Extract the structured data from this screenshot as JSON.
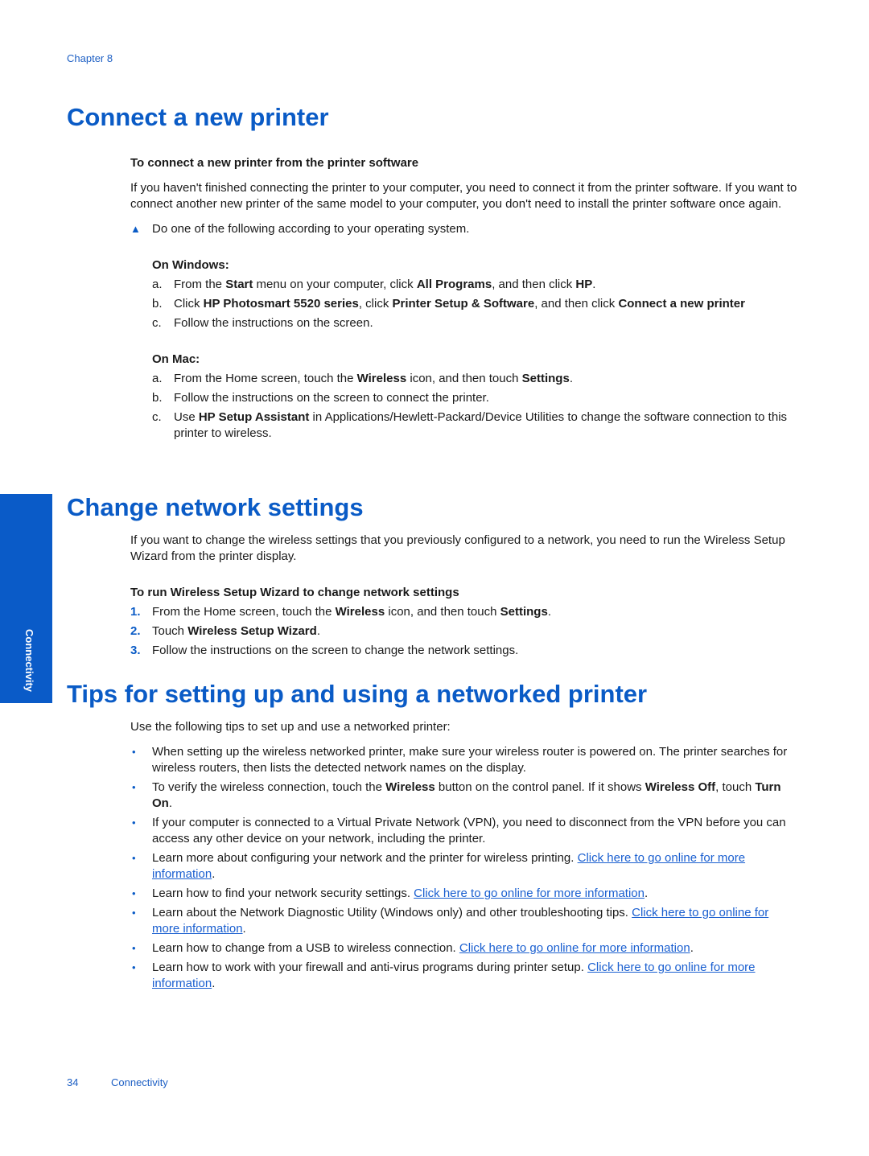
{
  "header": {
    "chapter": "Chapter 8"
  },
  "section1": {
    "title": "Connect a new printer",
    "subheading": "To connect a new printer from the printer software",
    "intro": "If you haven't finished connecting the printer to your computer, you need to connect it from the printer software. If you want to connect another new printer of the same model to your computer, you don't need to install the printer software once again.",
    "instruction": "Do one of the following according to your operating system.",
    "windows": {
      "label": "On Windows:",
      "steps": [
        {
          "marker": "a.",
          "parts": [
            "From the ",
            "Start",
            " menu on your computer, click ",
            "All Programs",
            ", and then click ",
            "HP",
            "."
          ]
        },
        {
          "marker": "b.",
          "parts": [
            "Click ",
            "HP Photosmart 5520 series",
            ", click ",
            "Printer Setup & Software",
            ", and then click ",
            "Connect a new printer",
            ""
          ]
        },
        {
          "marker": "c.",
          "parts": [
            "Follow the instructions on the screen."
          ]
        }
      ]
    },
    "mac": {
      "label": "On Mac:",
      "steps": [
        {
          "marker": "a.",
          "parts": [
            "From the Home screen, touch the ",
            "Wireless",
            " icon, and then touch ",
            "Settings",
            "."
          ]
        },
        {
          "marker": "b.",
          "parts": [
            "Follow the instructions on the screen to connect the printer."
          ]
        },
        {
          "marker": "c.",
          "parts": [
            "Use ",
            "HP Setup Assistant",
            " in Applications/Hewlett-Packard/Device Utilities to change the software connection to this printer to wireless."
          ]
        }
      ]
    }
  },
  "section2": {
    "title": "Change network settings",
    "intro": "If you want to change the wireless settings that you previously configured to a network, you need to run the Wireless Setup Wizard from the printer display.",
    "subheading": "To run Wireless Setup Wizard to change network settings",
    "steps": [
      {
        "marker": "1.",
        "parts": [
          "From the Home screen, touch the ",
          "Wireless",
          " icon, and then touch ",
          "Settings",
          "."
        ]
      },
      {
        "marker": "2.",
        "parts": [
          "Touch ",
          "Wireless Setup Wizard",
          "."
        ]
      },
      {
        "marker": "3.",
        "parts": [
          "Follow the instructions on the screen to change the network settings."
        ]
      }
    ]
  },
  "section3": {
    "title": "Tips for setting up and using a networked printer",
    "intro": "Use the following tips to set up and use a networked printer:",
    "tips": [
      {
        "parts": [
          "When setting up the wireless networked printer, make sure your wireless router is powered on. The printer searches for wireless routers, then lists the detected network names on the display."
        ]
      },
      {
        "parts": [
          "To verify the wireless connection, touch the ",
          "Wireless",
          " button on the control panel. If it shows ",
          "Wireless Off",
          ", touch ",
          "Turn On",
          "."
        ]
      },
      {
        "parts": [
          "If your computer is connected to a Virtual Private Network (VPN), you need to disconnect from the VPN before you can access any other device on your network, including the printer."
        ]
      },
      {
        "text": "Learn more about configuring your network and the printer for wireless printing. ",
        "link": "Click here to go online for more information",
        "after": "."
      },
      {
        "text": "Learn how to find your network security settings. ",
        "link": "Click here to go online for more information",
        "after": "."
      },
      {
        "text": "Learn about the Network Diagnostic Utility (Windows only) and other troubleshooting tips. ",
        "link": "Click here to go online for more information",
        "after": "."
      },
      {
        "text": "Learn how to change from a USB to wireless connection. ",
        "link": "Click here to go online for more information",
        "after": "."
      },
      {
        "text": "Learn how to work with your firewall and anti-virus programs during printer setup. ",
        "link": "Click here to go online for more information",
        "after": "."
      }
    ]
  },
  "sidetab": {
    "label": "Connectivity"
  },
  "footer": {
    "page_number": "34",
    "section": "Connectivity"
  },
  "icons": {
    "triangle": "▲",
    "bullet": "•"
  },
  "colors": {
    "accent": "#0a5bc6",
    "link": "#1a5fd0"
  }
}
